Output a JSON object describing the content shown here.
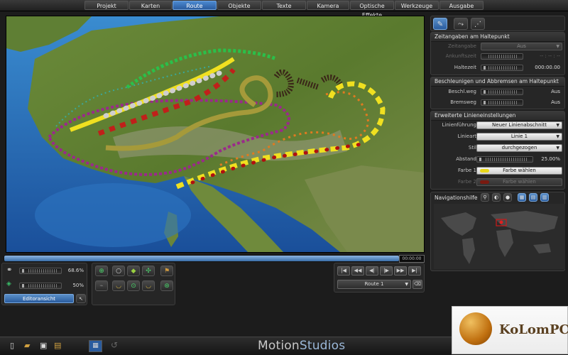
{
  "menu": {
    "tabs": [
      {
        "label": "Projekt",
        "active": false
      },
      {
        "label": "Karten",
        "active": false
      },
      {
        "label": "Route",
        "active": true
      },
      {
        "label": "Objekte",
        "active": false
      },
      {
        "label": "Texte",
        "active": false
      },
      {
        "label": "Kamera",
        "active": false
      },
      {
        "label": "Optische Effekte",
        "active": false
      },
      {
        "label": "Werkzeuge",
        "active": false
      },
      {
        "label": "Ausgabe",
        "active": false
      }
    ]
  },
  "timeline": {
    "timecode": "00:00:00"
  },
  "panel_stop": {
    "title": "Zeitangaben am Haltepunkt",
    "zeitangabe_label": "Zeitangabe",
    "zeitangabe_value": "Aus",
    "ankunft_label": "Ankunftszeit",
    "ankunft_value": "-- : -- : --",
    "haltezeit_label": "Haltezeit",
    "haltezeit_value": "000:00.00"
  },
  "panel_accel": {
    "title": "Beschleunigen und Abbremsen am Haltepunkt",
    "beschl_label": "Beschl.weg",
    "beschl_value": "Aus",
    "brems_label": "Bremsweg",
    "brems_value": "Aus"
  },
  "panel_line": {
    "title": "Erweiterte Linieneinstellungen",
    "fuehrung_label": "Linienführung",
    "fuehrung_value": "Neuer Linienabschnitt",
    "art_label": "Linieart",
    "art_value": "Linie 1",
    "stil_label": "Stil",
    "stil_value": "durchgezogen",
    "abstand_label": "Abstand",
    "abstand_value": "25.00%",
    "farbe1_label": "Farbe 1",
    "farbe1_button": "Farbe wählen",
    "farbe1_color": "#e8d81a",
    "farbe2_label": "Farbe 2",
    "farbe2_button": "Farbe wählen",
    "farbe2_color": "#7a1a10"
  },
  "navigation": {
    "title": "Navigationshilfe"
  },
  "left_controls": {
    "value1": "68.6%",
    "value2": "50%",
    "editor_button": "Editoransicht"
  },
  "route_selector": {
    "value": "Route 1"
  },
  "branding": {
    "logo_part1": "Motion",
    "logo_part2": "Studios",
    "watermark": "KoLomPC"
  },
  "colors": {
    "accent": "#2a5c9e",
    "route_yellow": "#e8d81a",
    "route_red": "#c0201a",
    "route_purple": "#9a2a8a"
  }
}
